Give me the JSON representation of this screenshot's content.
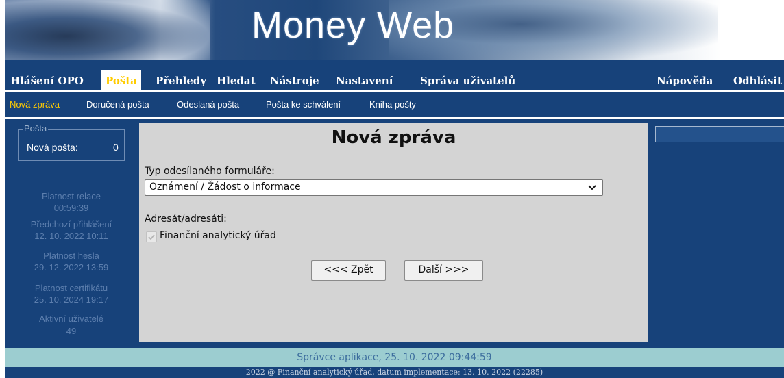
{
  "banner": {
    "logo_text": "Money Web"
  },
  "main_nav": {
    "items": [
      {
        "label": "Hlášení OPO"
      },
      {
        "label": "Pošta"
      },
      {
        "label": "Přehledy"
      },
      {
        "label": "Hledat"
      },
      {
        "label": "Nástroje"
      },
      {
        "label": "Nastavení"
      },
      {
        "label": "Správa uživatelů"
      },
      {
        "label": "Nápověda"
      },
      {
        "label": "Odhlásit"
      }
    ],
    "active": "Pošta",
    "active_color": "#ffcc00"
  },
  "sub_nav": {
    "items": [
      {
        "label": "Nová zpráva"
      },
      {
        "label": "Doručená pošta"
      },
      {
        "label": "Odeslaná pošta"
      },
      {
        "label": "Pošta ke schválení"
      },
      {
        "label": "Kniha pošty"
      }
    ],
    "active": "Nová zpráva"
  },
  "sidebar": {
    "mailbox": {
      "legend": "Pošta",
      "label": "Nová pošta:",
      "count": "0"
    },
    "info": [
      {
        "label": "Platnost relace",
        "value": "00:59:39"
      },
      {
        "label": "Předchozí přihlášení",
        "value": "12. 10. 2022 10:11"
      },
      {
        "label": "Platnost hesla",
        "value": "29. 12. 2022 13:59"
      },
      {
        "label": "Platnost certifikátu",
        "value": "25. 10. 2024 19:17"
      },
      {
        "label": "Aktivní uživatelé",
        "value": "49"
      }
    ]
  },
  "content": {
    "title": "Nová zpráva",
    "form_type_label": "Typ odesílaného formuláře:",
    "form_type_value": "Oznámení / Žádost o informace",
    "recipients_label": "Adresát/adresáti:",
    "recipient": {
      "label": "Finanční analytický úřad",
      "checked": true,
      "disabled": true
    },
    "back_button": "<<< Zpět",
    "next_button": "Další >>>"
  },
  "footer": {
    "admin": "Správce aplikace, 25. 10. 2022 09:44:59",
    "copyright": "2022 @ Finanční analytický úřad, datum implementace: 13. 10. 2022 (22285)"
  },
  "colors": {
    "navy": "#17427a",
    "highlight": "#ffcc00",
    "content_bg": "#d4d4d4",
    "footer_bg": "#9ccdd0"
  },
  "icons": {
    "select_chevron": "chevron-down-icon",
    "checkbox": "checkmark-icon"
  }
}
